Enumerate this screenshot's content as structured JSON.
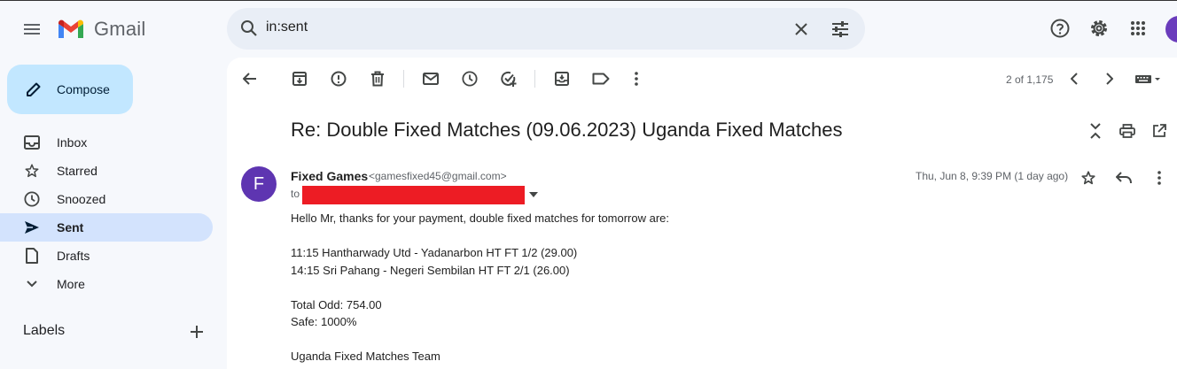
{
  "header": {
    "app_name": "Gmail",
    "search_value": "in:sent",
    "icons": [
      "menu-icon",
      "search-icon",
      "close-icon",
      "tune-icon",
      "help-icon",
      "settings-icon",
      "apps-icon"
    ]
  },
  "sidebar": {
    "compose_label": "Compose",
    "items": [
      {
        "label": "Inbox",
        "icon": "inbox-icon"
      },
      {
        "label": "Starred",
        "icon": "star-icon"
      },
      {
        "label": "Snoozed",
        "icon": "clock-icon"
      },
      {
        "label": "Sent",
        "icon": "send-icon",
        "active": true
      },
      {
        "label": "Drafts",
        "icon": "draft-icon"
      },
      {
        "label": "More",
        "icon": "chevron-down-icon"
      }
    ],
    "labels_title": "Labels"
  },
  "toolbar": {
    "pager": "2 of 1,175"
  },
  "message": {
    "subject": "Re: Double Fixed Matches (09.06.2023) Uganda Fixed Matches",
    "sender_initial": "F",
    "sender_name": "Fixed Games",
    "sender_email": "<gamesfixed45@gmail.com>",
    "to_label": "to",
    "date": "Thu, Jun 8, 9:39 PM (1 day ago)",
    "body": {
      "greeting": "Hello Mr, thanks for your payment, double fixed matches for tomorrow are:",
      "match1": "11:15 Hantharwady Utd - Yadanarbon HT FT 1/2 (29.00)",
      "match2": "14:15 Sri Pahang - Negeri Sembilan HT FT 2/1 (26.00)",
      "total": "Total Odd: 754.00",
      "safe": "Safe: 1000%",
      "signature": "Uganda Fixed Matches Team"
    }
  },
  "colors": {
    "accent": "#c2e7ff",
    "active_nav": "#d3e3fd",
    "redaction": "#ed1c24",
    "avatar": "#5e35b1"
  }
}
